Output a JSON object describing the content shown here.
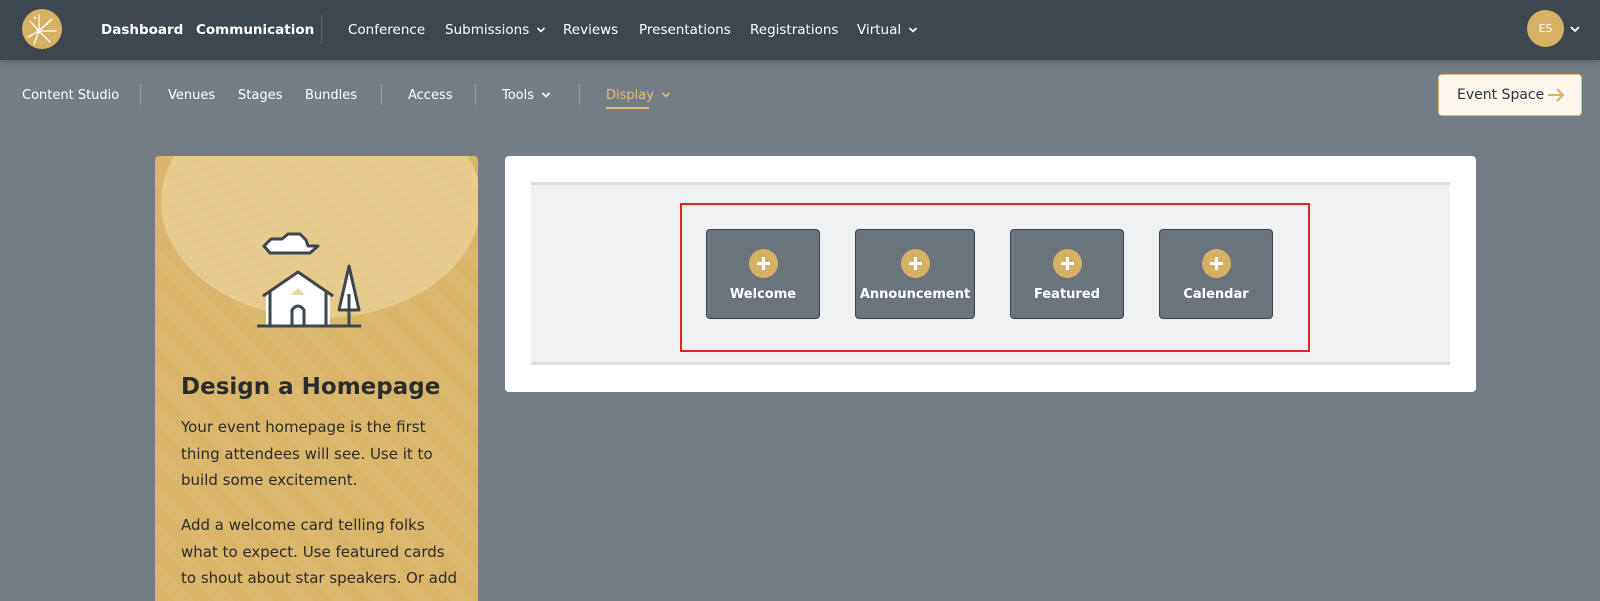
{
  "topnav": {
    "items": [
      {
        "label": "Dashboard",
        "bold": true
      },
      {
        "label": "Communication",
        "bold": true
      },
      {
        "label": "Conference",
        "bold": false
      },
      {
        "label": "Submissions",
        "bold": false,
        "dropdown": true
      },
      {
        "label": "Reviews",
        "bold": false
      },
      {
        "label": "Presentations",
        "bold": false
      },
      {
        "label": "Registrations",
        "bold": false
      },
      {
        "label": "Virtual",
        "bold": false,
        "dropdown": true
      }
    ],
    "avatar_initials": "ES"
  },
  "subnav": {
    "items": [
      {
        "label": "Content Studio"
      },
      {
        "label": "Venues"
      },
      {
        "label": "Stages"
      },
      {
        "label": "Bundles"
      },
      {
        "label": "Access"
      },
      {
        "label": "Tools",
        "dropdown": true
      },
      {
        "label": "Display",
        "dropdown": true,
        "active": true
      }
    ],
    "event_space_label": "Event Space"
  },
  "info_card": {
    "title": "Design a Homepage",
    "paragraphs": [
      "Your event homepage is the first thing attendees will see. Use it to build some excitement.",
      "Add a welcome card telling folks what to expect. Use featured cards to shout about star speakers. Or add an"
    ]
  },
  "builder": {
    "cards": [
      {
        "label": "Welcome"
      },
      {
        "label": "Announcement"
      },
      {
        "label": "Featured"
      },
      {
        "label": "Calendar"
      }
    ]
  },
  "colors": {
    "accent": "#d6b063",
    "topbar": "#3e4650",
    "background": "#747d86",
    "highlight": "#e0261c"
  }
}
